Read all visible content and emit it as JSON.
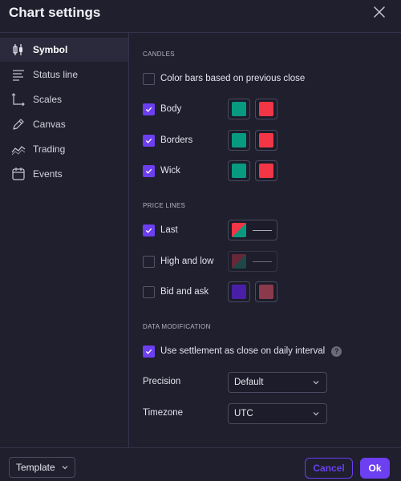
{
  "dialog": {
    "title": "Chart settings"
  },
  "sidebar": {
    "items": [
      {
        "label": "Symbol",
        "icon": "candles-icon",
        "active": true
      },
      {
        "label": "Status line",
        "icon": "status-line-icon",
        "active": false
      },
      {
        "label": "Scales",
        "icon": "scales-icon",
        "active": false
      },
      {
        "label": "Canvas",
        "icon": "pencil-icon",
        "active": false
      },
      {
        "label": "Trading",
        "icon": "trading-icon",
        "active": false
      },
      {
        "label": "Events",
        "icon": "calendar-icon",
        "active": false
      }
    ]
  },
  "sections": {
    "candles": {
      "title": "CANDLES",
      "color_bars_label": "Color bars based on previous close",
      "color_bars_checked": false,
      "body_label": "Body",
      "body_checked": true,
      "borders_label": "Borders",
      "borders_checked": true,
      "wick_label": "Wick",
      "wick_checked": true,
      "up_color": "#089981",
      "down_color": "#f23645"
    },
    "price_lines": {
      "title": "PRICE LINES",
      "last_label": "Last",
      "last_checked": true,
      "high_low_label": "High and low",
      "high_low_checked": false,
      "bid_ask_label": "Bid and ask",
      "bid_ask_checked": false,
      "bid_color": "#4a1fa8",
      "ask_color": "#8a3a4a"
    },
    "data_modification": {
      "title": "DATA MODIFICATION",
      "settlement_label": "Use settlement as close on daily interval",
      "settlement_checked": true,
      "help_glyph": "?",
      "precision_label": "Precision",
      "precision_value": "Default",
      "timezone_label": "Timezone",
      "timezone_value": "UTC"
    }
  },
  "footer": {
    "template_label": "Template",
    "cancel_label": "Cancel",
    "ok_label": "Ok"
  },
  "colors": {
    "accent": "#6c3ff0",
    "background": "#1f1f2e"
  }
}
